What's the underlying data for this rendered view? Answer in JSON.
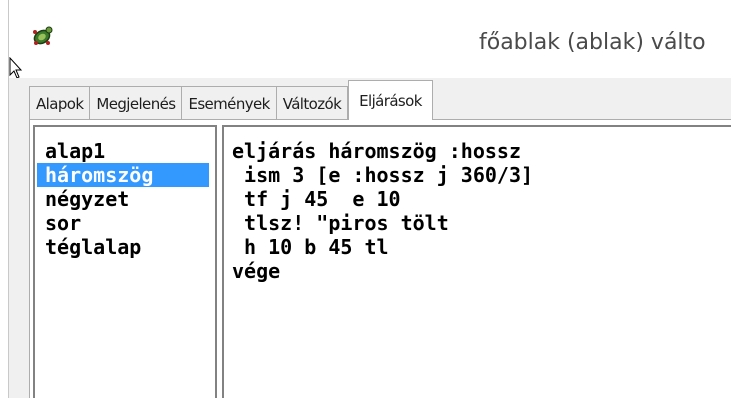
{
  "window": {
    "title": "főablak (ablak) válto"
  },
  "tabs": [
    {
      "label": "Alapok"
    },
    {
      "label": "Megjelenés"
    },
    {
      "label": "Események"
    },
    {
      "label": "Változók"
    },
    {
      "label": "Eljárások"
    }
  ],
  "procedures": {
    "items": [
      {
        "label": "alap1"
      },
      {
        "label": "háromszög"
      },
      {
        "label": "négyzet"
      },
      {
        "label": "sor"
      },
      {
        "label": "téglalap"
      }
    ],
    "selected": "háromszög"
  },
  "editor": {
    "lines": [
      "eljárás háromszög :hossz",
      " ism 3 [e :hossz j 360/3]",
      " tf j 45  e 10",
      " tlsz! \"piros tölt",
      " h 10 b 45 tl",
      "vége"
    ]
  },
  "colors": {
    "selection": "#3399ff",
    "border": "#828282",
    "tab_border": "#adadad"
  },
  "icons": {
    "app": "turtle-icon",
    "cursor": "mouse-pointer-icon"
  }
}
